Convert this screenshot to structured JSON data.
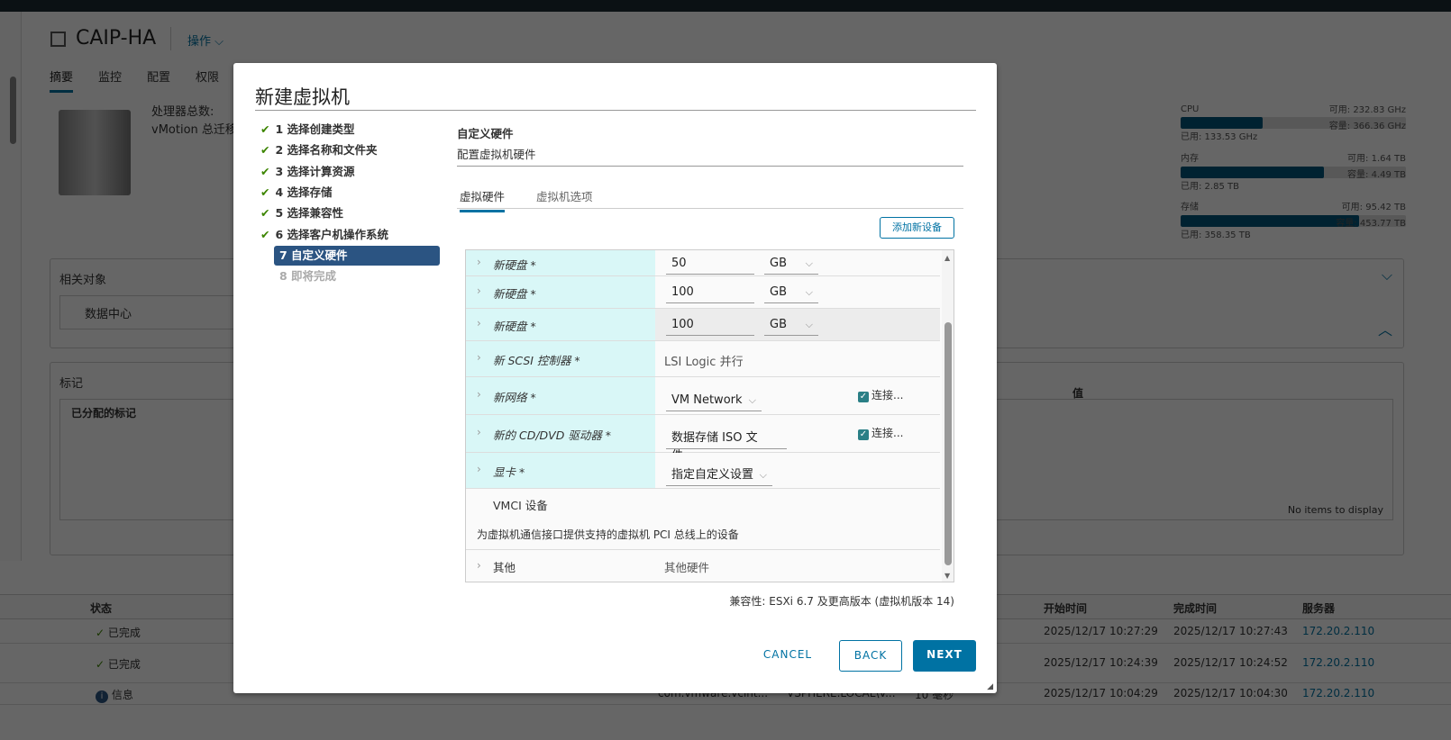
{
  "host": {
    "title": "CAIP-HA",
    "actions": "操作",
    "tabs": [
      "摘要",
      "监控",
      "配置",
      "权限"
    ],
    "info": [
      "处理器总数:",
      "vMotion 总迁移"
    ]
  },
  "resources": [
    {
      "name": "CPU",
      "free": "可用: 232.83 GHz",
      "used": "已用: 133.53 GHz",
      "cap": "容量: 366.36 GHz",
      "pct": 36.4
    },
    {
      "name": "内存",
      "free": "可用: 1.64 TB",
      "used": "已用: 2.85 TB",
      "cap": "容量: 4.49 TB",
      "pct": 63.5
    },
    {
      "name": "存储",
      "free": "可用: 95.42 TB",
      "used": "已用: 358.35 TB",
      "cap": "容量: 453.77 TB",
      "pct": 79.0
    }
  ],
  "panels": {
    "related": "相关对象",
    "datacenter": "数据中心",
    "tags": "标记",
    "assigned": "已分配的标记",
    "value": "值",
    "empty": "No items to display"
  },
  "tasks": {
    "headers": [
      "状态",
      "开始时间",
      "完成时间",
      "服务器"
    ],
    "rows": [
      {
        "status": "已完成",
        "start": "2025/12/17 10:27:29",
        "end": "2025/12/17 10:27:43",
        "server": "172.20.2.110"
      },
      {
        "status": "已完成",
        "start": "2025/12/17 10:24:39",
        "end": "2025/12/17 10:24:52",
        "server": "172.20.2.110"
      },
      {
        "status": "信息",
        "c1": "com.vmware.vcint...",
        "c2": "VSPHERE.LOCAL\\V...",
        "c3": "10 毫秒",
        "start": "2025/12/17 10:04:29",
        "end": "2025/12/17 10:04:30",
        "server": "172.20.2.110"
      }
    ]
  },
  "wizard": {
    "title": "新建虚拟机",
    "steps": [
      "1 选择创建类型",
      "2 选择名称和文件夹",
      "3 选择计算资源",
      "4 选择存储",
      "5 选择兼容性",
      "6 选择客户机操作系统",
      "7 自定义硬件",
      "8 即将完成"
    ],
    "section_title": "自定义硬件",
    "section_sub": "配置虚拟机硬件",
    "tabs": [
      "虚拟硬件",
      "虚拟机选项"
    ],
    "add_device": "添加新设备",
    "hardware": [
      {
        "name": "新硬盘 *",
        "value": "50",
        "unit": "GB"
      },
      {
        "name": "新硬盘 *",
        "value": "100",
        "unit": "GB"
      },
      {
        "name": "新硬盘 *",
        "value": "100",
        "unit": "GB"
      },
      {
        "name": "新 SCSI 控制器 *",
        "value": "LSI Logic 并行"
      },
      {
        "name": "新网络 *",
        "value": "VM Network",
        "connect": "连接..."
      },
      {
        "name": "新的 CD/DVD 驱动器 *",
        "value": "数据存储 ISO 文件",
        "connect": "连接..."
      },
      {
        "name": "显卡 *",
        "value": "指定自定义设置"
      }
    ],
    "vmci": {
      "name": "VMCI 设备",
      "desc": "为虚拟机通信接口提供支持的虚拟机 PCI 总线上的设备"
    },
    "other": {
      "name": "其他",
      "value": "其他硬件"
    },
    "compat": "兼容性: ESXi 6.7 及更高版本 (虚拟机版本 14)",
    "cancel": "CANCEL",
    "back": "BACK",
    "next": "NEXT"
  }
}
